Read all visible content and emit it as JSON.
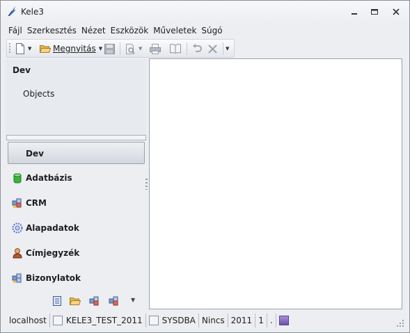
{
  "window": {
    "title": "Kele3"
  },
  "menubar": {
    "items": [
      {
        "label": "Fájl",
        "icon": "none"
      },
      {
        "label": "Szerkesztés"
      },
      {
        "label": "Nézet"
      },
      {
        "label": "Eszközök"
      },
      {
        "label": "Műveletek"
      },
      {
        "label": "Súgó"
      }
    ]
  },
  "toolbar": {
    "open_label": "Megnyitás",
    "icons": [
      "new-document-icon",
      "open-folder-icon",
      "save-icon",
      "print-preview-icon",
      "print-icon",
      "book-icon",
      "undo-icon",
      "delete-icon",
      "toolbar-options-icon"
    ]
  },
  "left_panel": {
    "pane_title": "Dev",
    "pane_items": [
      "Objects"
    ],
    "nav": [
      {
        "label": "Dev",
        "active": true,
        "icon": "none"
      },
      {
        "label": "Adatbázis",
        "icon": "database-icon"
      },
      {
        "label": "CRM",
        "icon": "crm-icon"
      },
      {
        "label": "Alapadatok",
        "icon": "basedata-icon"
      },
      {
        "label": "Címjegyzék",
        "icon": "contacts-icon"
      },
      {
        "label": "Bizonylatok",
        "icon": "documents-icon"
      }
    ],
    "footer_icons": [
      "note-icon",
      "folder-icon",
      "crm-small-icon",
      "documents-small-icon",
      "more-arrow-icon"
    ]
  },
  "statusbar": {
    "host": "localhost",
    "database": "KELE3_TEST_2011",
    "user": "SYSDBA",
    "status": "Nincs",
    "year": "2011",
    "number": "1",
    "dot": ".",
    "accent": "#7a5cb8"
  },
  "colors": {
    "window_bg": "#eceef2",
    "content_bg": "#ffffff",
    "active_nav": "#d3d7de"
  }
}
